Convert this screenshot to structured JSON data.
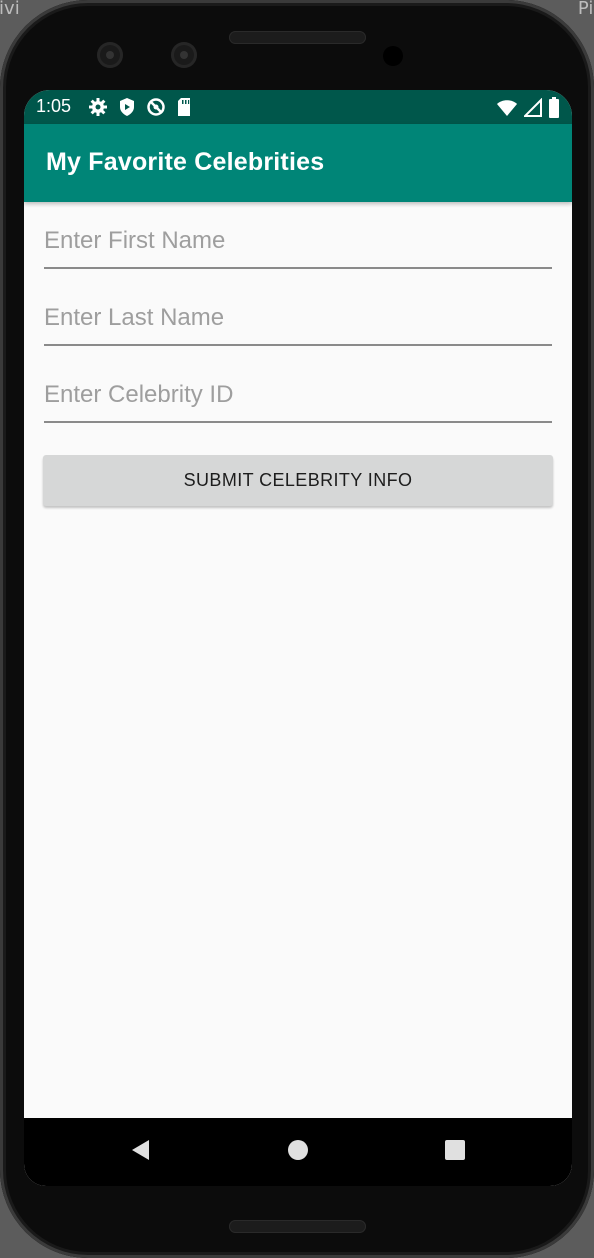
{
  "background": {
    "left_text": "tivi",
    "right_text": "Pix"
  },
  "status_bar": {
    "time": "1:05",
    "left_icons": [
      "gear-icon",
      "shield-play-icon",
      "no-disturb-icon",
      "sd-card-icon"
    ],
    "right_icons": [
      "wifi-icon",
      "cell-signal-icon",
      "battery-icon"
    ]
  },
  "app_bar": {
    "title": "My Favorite Celebrities",
    "color": "#008577",
    "status_color": "#00574b"
  },
  "form": {
    "first_name": {
      "placeholder": "Enter First Name",
      "value": ""
    },
    "last_name": {
      "placeholder": "Enter Last Name",
      "value": ""
    },
    "celebrity_id": {
      "placeholder": "Enter Celebrity ID",
      "value": ""
    },
    "submit_label": "SUBMIT CELEBRITY INFO"
  },
  "nav_bar": {
    "buttons": [
      "back-icon",
      "home-icon",
      "recent-apps-icon"
    ]
  }
}
